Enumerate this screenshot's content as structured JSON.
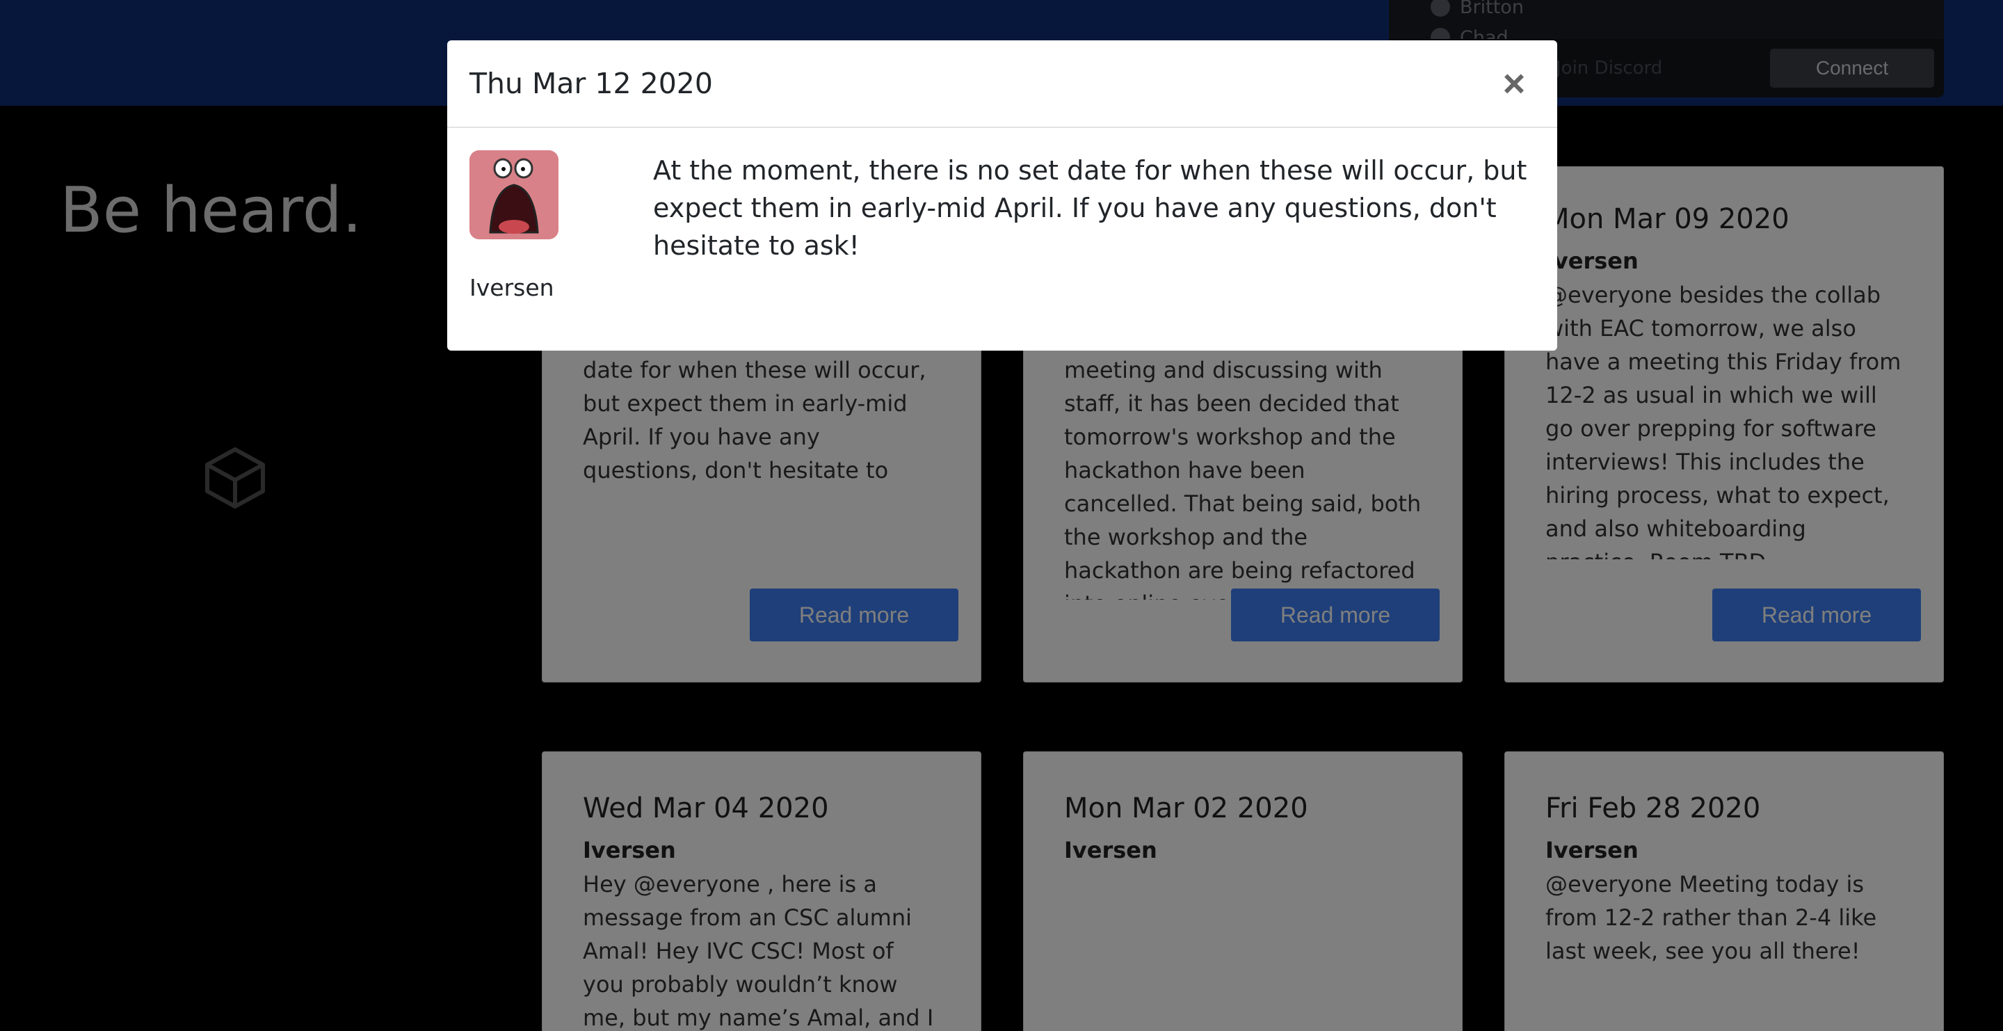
{
  "discord": {
    "members": [
      "Britton",
      "Chad"
    ],
    "footer_hint": "Join Discord",
    "connect_label": "Connect"
  },
  "hero": {
    "title": "Be heard."
  },
  "cards": [
    {
      "date": "",
      "author": "",
      "body": "date for when these will occur, but expect them in early-mid April. If you have any questions, don't hesitate to ask!",
      "button": "Read more"
    },
    {
      "date": "",
      "author": "",
      "body": "meeting and discussing with staff, it has been decided that tomorrow's workshop and the hackathon have been cancelled. That being said, both the workshop and the hackathon are being refactored into online events and still happen!",
      "button": "Read more"
    },
    {
      "date": "Mon Mar 09 2020",
      "author": "Iversen",
      "body": "@everyone besides the collab with EAC tomorrow, we also have a meeting this Friday from 12-2 as usual in which we will go over prepping for software interviews! This includes the hiring process, what to expect, and also whiteboarding practice. Room TBD",
      "button": "Read more"
    },
    {
      "date": "Wed Mar 04 2020",
      "author": "Iversen",
      "body": "Hey @everyone , here is a message from an CSC alumni Amal! Hey IVC CSC! Most of you probably wouldn’t know me, but my name’s Amal, and I",
      "button": ""
    },
    {
      "date": "Mon Mar 02 2020",
      "author": "Iversen",
      "body": "",
      "button": ""
    },
    {
      "date": "Fri Feb 28 2020",
      "author": "Iversen",
      "body": "@everyone Meeting today is from 12-2 rather than 2-4 like last week, see you all there!",
      "button": ""
    }
  ],
  "modal": {
    "title": "Thu Mar 12 2020",
    "close_glyph": "×",
    "message": "At the moment, there is no set date for when these will occur, but expect them in early-mid April. If you have any questions, don't hesitate to ask!",
    "author": "Iversen"
  },
  "colors": {
    "topbar": "#0e2f78",
    "button": "#3d7ff2",
    "avatar_bg": "#d98188"
  },
  "icons": {
    "modal_avatar": "surprised-face-avatar-icon",
    "logo": "hexagon-logo-icon",
    "close": "close-icon"
  }
}
